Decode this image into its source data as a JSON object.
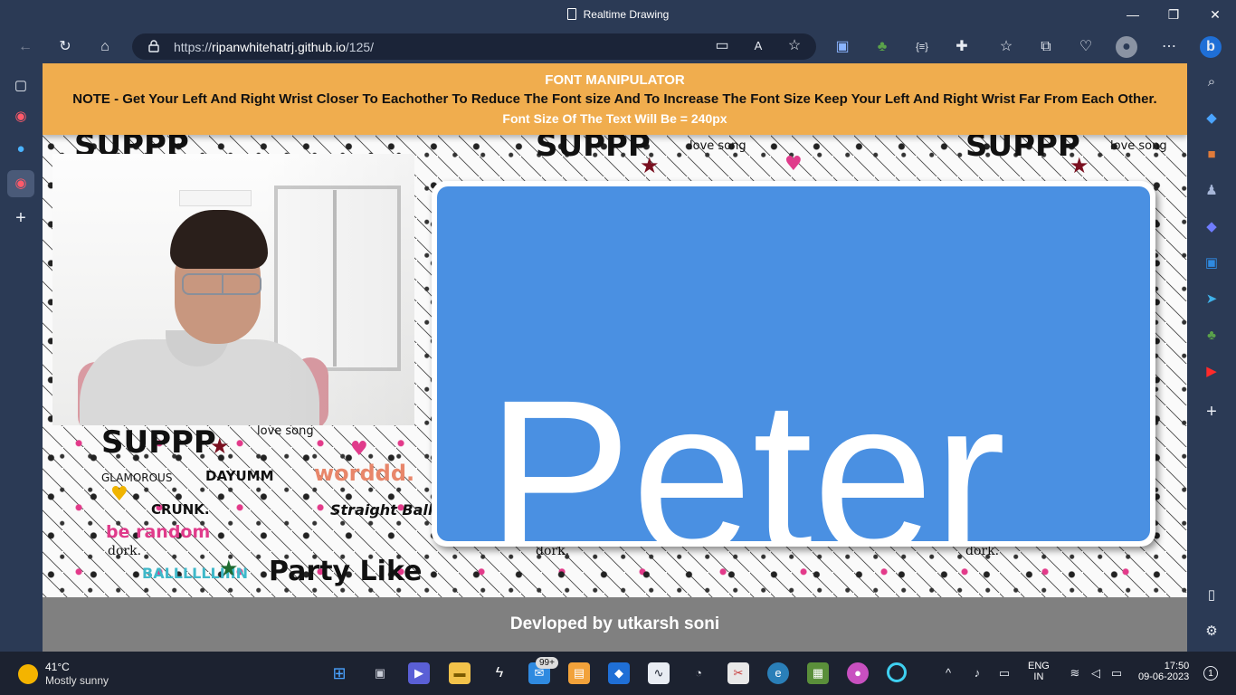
{
  "window": {
    "title": "Realtime Drawing",
    "minimize": "—",
    "restore": "❐",
    "close": "✕"
  },
  "toolbar": {
    "url_prefix": "https://",
    "url_host": "ripanwhitehatrj.github.io",
    "url_path": "/125/"
  },
  "banner": {
    "heading": "FONT MANIPULATOR",
    "note": "NOTE - Get Your Left And Right Wrist Closer To Eachother To Reduce The Font size And To Increase The Font Size Keep Your Left And Right Wrist Far From Each Other.",
    "font_size_text": "Font Size Of The Text Will Be = 240px"
  },
  "canvas": {
    "display_text": "Peter",
    "font_size_px": 240,
    "background_color": "#4a90e2",
    "text_color": "#ffffff"
  },
  "doodle_words": [
    "SUPPP",
    "DAYUMM",
    "worddd.",
    "CRUNK.",
    "be random",
    "dork.",
    "BALLLLLLIIIN",
    "Party Like",
    "GLAMOROUS",
    "Straight Ballin'",
    "love song"
  ],
  "footer": {
    "credit": "Devloped by utkarsh soni"
  },
  "taskbar": {
    "weather_temp": "41°C",
    "weather_desc": "Mostly sunny",
    "mail_badge": "99+",
    "lang_1": "ENG",
    "lang_2": "IN",
    "time": "17:50",
    "date": "09-06-2023",
    "notification_count": "1"
  },
  "colors": {
    "browser_chrome": "#2b3a55",
    "banner": "#f0ad4e",
    "footer": "#808080",
    "taskbar": "#1c2230"
  }
}
